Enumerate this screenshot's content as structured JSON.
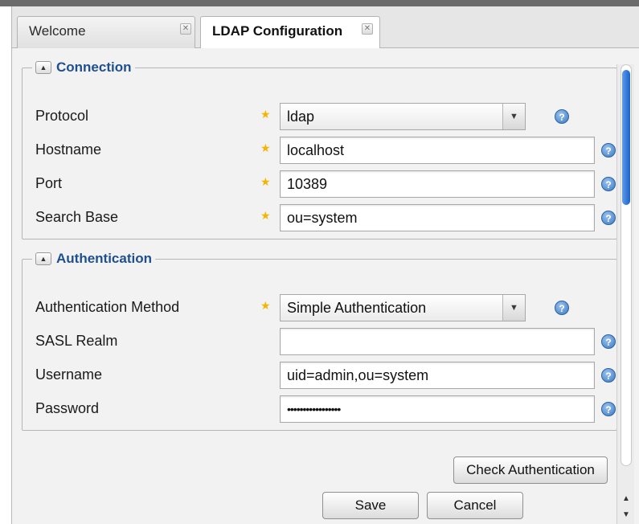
{
  "tabs": [
    {
      "label": "Welcome",
      "active": false
    },
    {
      "label": "LDAP Configuration",
      "active": true
    }
  ],
  "connection": {
    "legend": "Connection",
    "fields": [
      {
        "label": "Protocol",
        "required": true,
        "type": "select",
        "value": "ldap"
      },
      {
        "label": "Hostname",
        "required": true,
        "type": "text",
        "value": "localhost"
      },
      {
        "label": "Port",
        "required": true,
        "type": "text",
        "value": "10389"
      },
      {
        "label": "Search Base",
        "required": true,
        "type": "text",
        "value": "ou=system"
      }
    ]
  },
  "authentication": {
    "legend": "Authentication",
    "fields": [
      {
        "label": "Authentication Method",
        "required": true,
        "type": "select",
        "value": "Simple Authentication"
      },
      {
        "label": "SASL Realm",
        "required": false,
        "type": "text",
        "value": ""
      },
      {
        "label": "Username",
        "required": false,
        "type": "text",
        "value": "uid=admin,ou=system"
      },
      {
        "label": "Password",
        "required": false,
        "type": "password",
        "value": "•••••••••••••••••"
      }
    ]
  },
  "buttons": {
    "check_authentication": "Check Authentication",
    "save": "Save",
    "cancel": "Cancel"
  },
  "icons": {
    "required": "star-icon",
    "help": "help-icon",
    "collapse": "collapse-up-icon"
  },
  "colors": {
    "legend_text": "#1f4f8f",
    "required_star": "#f5b400",
    "help_icon": "#3a78c0",
    "scroll_thumb": "#1b62cc"
  }
}
